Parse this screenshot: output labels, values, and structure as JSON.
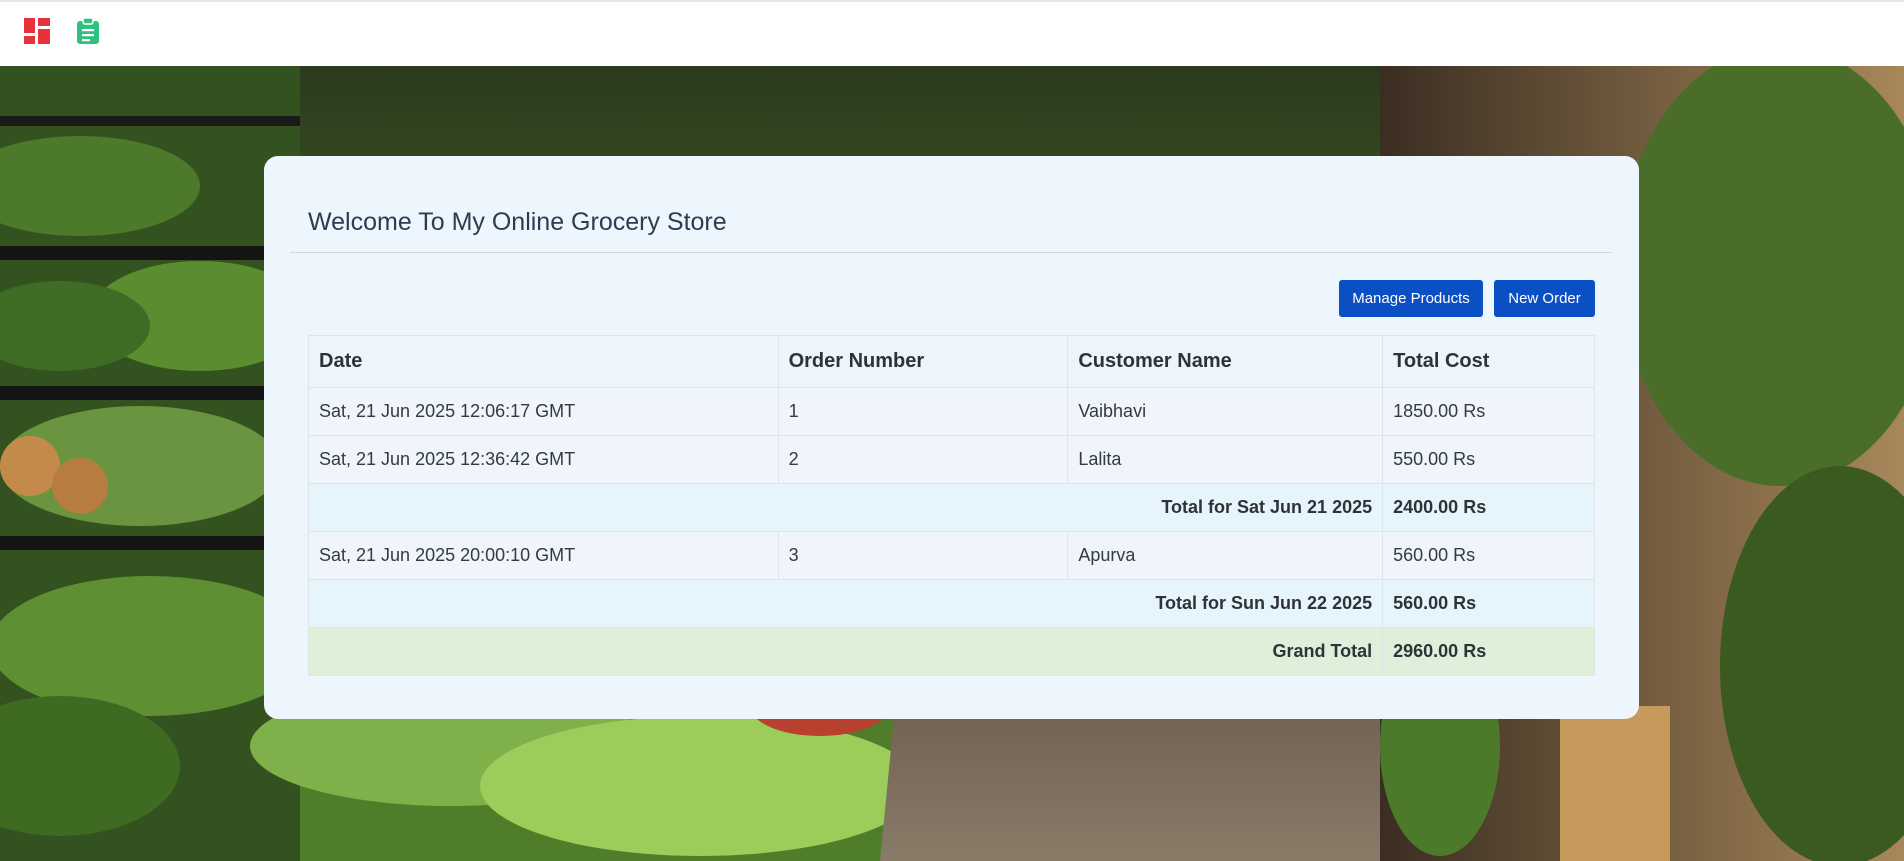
{
  "nav": {
    "dashboard_icon": "dashboard-grid-icon",
    "orders_icon": "clipboard-icon",
    "dashboard_color": "#e8323b",
    "orders_color": "#2ec27e"
  },
  "card": {
    "title": "Welcome To My Online Grocery Store",
    "buttons": {
      "manage_products": "Manage Products",
      "new_order": "New Order"
    },
    "accent_color": "#0b4fc5"
  },
  "table": {
    "headers": [
      "Date",
      "Order Number",
      "Customer Name",
      "Total Cost"
    ],
    "rows": [
      {
        "date": "Sat, 21 Jun 2025 12:06:17 GMT",
        "order_number": "1",
        "customer": "Vaibhavi",
        "total": "1850.00 Rs"
      },
      {
        "date": "Sat, 21 Jun 2025 12:36:42 GMT",
        "order_number": "2",
        "customer": "Lalita",
        "total": "550.00 Rs"
      }
    ],
    "subtotal_1": {
      "label": "Total for Sat Jun 21 2025",
      "value": "2400.00 Rs"
    },
    "rows_2": [
      {
        "date": "Sat, 21 Jun 2025 20:00:10 GMT",
        "order_number": "3",
        "customer": "Apurva",
        "total": "560.00 Rs"
      }
    ],
    "subtotal_2": {
      "label": "Total for Sun Jun 22 2025",
      "value": "560.00 Rs"
    },
    "grand_total": {
      "label": "Grand Total",
      "value": "2960.00 Rs"
    }
  }
}
